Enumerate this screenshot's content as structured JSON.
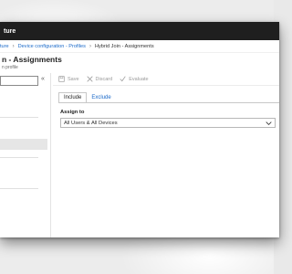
{
  "app": {
    "title": "ture"
  },
  "breadcrumbs": [
    {
      "label": "ture"
    },
    {
      "label": "Device configuration - Profiles"
    },
    {
      "label": "Hybrid Join - Assignments"
    }
  ],
  "blade": {
    "title": "n - Assignments",
    "subtitle": "n profile"
  },
  "toolbar": {
    "save_label": "Save",
    "discard_label": "Discard",
    "evaluate_label": "Evaluate"
  },
  "tabs": [
    {
      "label": "Include",
      "active": true
    },
    {
      "label": "Exclude",
      "active": false
    }
  ],
  "assign": {
    "label": "Assign to",
    "selected": "All Users & All Devices"
  },
  "icons": {
    "save": "save-icon",
    "discard": "close-icon",
    "evaluate": "checkmark-icon",
    "collapse": "double-chevron-left-icon",
    "dropdown": "chevron-down-icon"
  },
  "colors": {
    "topbar": "#1f1f1f",
    "link": "#1b6ac9",
    "disabled": "#9a9a9a"
  }
}
